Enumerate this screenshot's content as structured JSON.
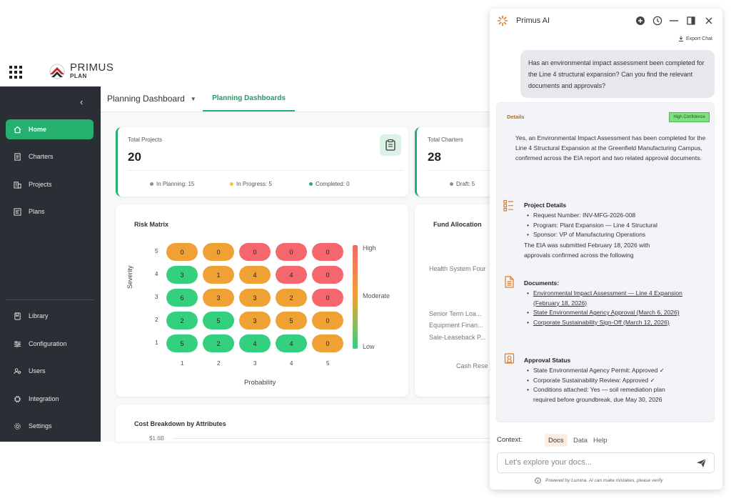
{
  "brand": {
    "name": "PRIMUS",
    "sub": "PLAN"
  },
  "sidebar": {
    "collapse_icon": "chevron-left-icon",
    "items": [
      {
        "label": "Home",
        "icon": "home-icon",
        "active": true
      },
      {
        "label": "Charters",
        "icon": "document-icon"
      },
      {
        "label": "Projects",
        "icon": "building-icon"
      },
      {
        "label": "Plans",
        "icon": "plan-icon"
      },
      {
        "label": "Library",
        "icon": "book-icon"
      },
      {
        "label": "Configuration",
        "icon": "sliders-icon"
      },
      {
        "label": "Users",
        "icon": "users-icon"
      },
      {
        "label": "Integration",
        "icon": "chip-icon"
      },
      {
        "label": "Settings",
        "icon": "gear-icon"
      }
    ]
  },
  "header": {
    "dropdown_title": "Planning Dashboard",
    "active_tab": "Planning Dashboards"
  },
  "stats": {
    "total_projects": {
      "label": "Total Projects",
      "value": "20",
      "in_planning": "In Planning: 15",
      "in_progress": "In Progress: 5",
      "completed": "Completed: 0"
    },
    "total_charters": {
      "label": "Total Charters",
      "value": "28",
      "draft": "Draft: 5"
    }
  },
  "risk_matrix": {
    "title": "Risk Matrix",
    "ylabel": "Severity",
    "xlabel": "Probability",
    "severity": [
      5,
      4,
      3,
      2,
      1
    ],
    "probability": [
      1,
      2,
      3,
      4,
      5
    ],
    "rows": [
      [
        {
          "v": "0",
          "c": "orange"
        },
        {
          "v": "0",
          "c": "orange"
        },
        {
          "v": "0",
          "c": "red"
        },
        {
          "v": "0",
          "c": "red"
        },
        {
          "v": "0",
          "c": "red"
        }
      ],
      [
        {
          "v": "3",
          "c": "green"
        },
        {
          "v": "1",
          "c": "orange"
        },
        {
          "v": "4",
          "c": "orange"
        },
        {
          "v": "4",
          "c": "red"
        },
        {
          "v": "0",
          "c": "red"
        }
      ],
      [
        {
          "v": "6",
          "c": "green"
        },
        {
          "v": "3",
          "c": "orange"
        },
        {
          "v": "3",
          "c": "orange"
        },
        {
          "v": "2",
          "c": "orange"
        },
        {
          "v": "0",
          "c": "red"
        }
      ],
      [
        {
          "v": "2",
          "c": "green"
        },
        {
          "v": "5",
          "c": "green"
        },
        {
          "v": "3",
          "c": "orange"
        },
        {
          "v": "5",
          "c": "orange"
        },
        {
          "v": "0",
          "c": "orange"
        }
      ],
      [
        {
          "v": "5",
          "c": "green"
        },
        {
          "v": "2",
          "c": "green"
        },
        {
          "v": "4",
          "c": "green"
        },
        {
          "v": "4",
          "c": "green"
        },
        {
          "v": "0",
          "c": "orange"
        }
      ]
    ],
    "legend": {
      "high": "High",
      "moderate": "Moderate",
      "low": "Low"
    },
    "colors": {
      "green": "#34d07f",
      "orange": "#f0a135",
      "red": "#f4676c"
    }
  },
  "fund_allocation": {
    "title": "Fund Allocation",
    "labels": [
      "Health System Four",
      "Senior Term Loa...",
      "Equipment Finan...",
      "Sale-Leaseback P...",
      "Cash Rese"
    ]
  },
  "cost_breakdown": {
    "title": "Cost Breakdown by Attributes",
    "first_tick": "$1.6B"
  },
  "ai_panel": {
    "title": "Primus AI",
    "export_label": "Export Chat",
    "user_message": "Has an environmental impact assessment been completed for the Line 4 structural expansion? Can you find the relevant documents and approvals?",
    "details_label": "Details",
    "confidence": "High Confidence",
    "summary": "Yes, an Environmental Impact Assessment has been completed for the Line 4 Structural Expansion at the Greenfield Manufacturing Campus, confirmed across the EIA report and two related approval documents.",
    "project_details": {
      "heading": "Project Details",
      "items": [
        "Request Number: INV-MFG-2026-008",
        "Program: Plant Expansion — Line 4 Structural",
        "Sponsor: VP of Manufacturing Operations"
      ],
      "note": "The EIA was submitted February 18, 2026 with approvals confirmed across the following"
    },
    "documents": {
      "heading": "Documents:",
      "items": [
        "Environmental Impact Assessment — Line 4 Expansion (February 18, 2026)",
        "State Environmental Agency Approval (March 6, 2026)",
        "Corporate Sustainability Sign-Off (March 12, 2026)"
      ]
    },
    "approval_status": {
      "heading": "Approval Status",
      "items": [
        "State Environmental Agency Permit: Approved ✓",
        "Corporate Sustainability Review: Approved ✓",
        "Conditions attached: Yes — soil remediation plan required before groundbreak, due May 30, 2026"
      ]
    },
    "context_label": "Context:",
    "context_options": [
      "Docs",
      "Data",
      "Help"
    ],
    "input_placeholder": "Let's explore your docs...",
    "footer": "Powered by Lumina. AI can make mistakes, please verify",
    "accent": "#e07a25"
  }
}
